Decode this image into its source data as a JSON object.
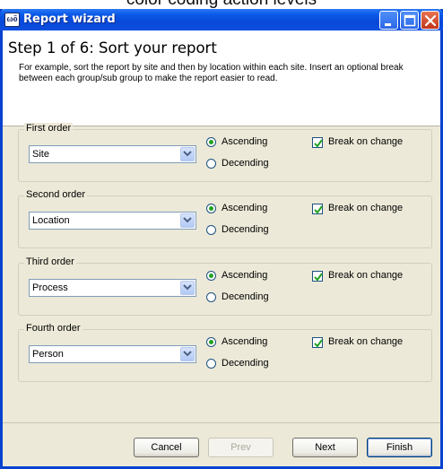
{
  "caption": "color coding action levels",
  "window": {
    "title": "Report wizard",
    "app_icon": "ωō"
  },
  "header": {
    "step_title": "Step 1 of 6: Sort your report",
    "description": "For example, sort the report by site and then by location within each site. Insert an optional break between each group/sub group to make the report easier to read."
  },
  "groups": [
    {
      "legend": "First order",
      "selected": "Site",
      "asc_label": "Ascending",
      "desc_label": "Decending",
      "asc_selected": true,
      "break_label": "Break on change",
      "break_checked": true
    },
    {
      "legend": "Second order",
      "selected": "Location",
      "asc_label": "Ascending",
      "desc_label": "Decending",
      "asc_selected": true,
      "break_label": "Break on change",
      "break_checked": true
    },
    {
      "legend": "Third order",
      "selected": "Process",
      "asc_label": "Ascending",
      "desc_label": "Decending",
      "asc_selected": true,
      "break_label": "Break on change",
      "break_checked": true
    },
    {
      "legend": "Fourth order",
      "selected": "Person",
      "asc_label": "Ascending",
      "desc_label": "Decending",
      "asc_selected": true,
      "break_label": "Break on change",
      "break_checked": true
    }
  ],
  "buttons": {
    "cancel": "Cancel",
    "prev": "Prev",
    "next": "Next",
    "finish": "Finish"
  },
  "icons": {
    "app": "report-wizard-app-icon",
    "minimize": "minimize-icon",
    "maximize": "maximize-icon",
    "close": "close-icon",
    "dropdown": "chevron-down-icon",
    "check": "checkmark-icon"
  },
  "colors": {
    "titlebar": "#0848d8",
    "close_button": "#c2351a",
    "window_bg": "#ece9d8",
    "radio_dot": "#21a121"
  }
}
